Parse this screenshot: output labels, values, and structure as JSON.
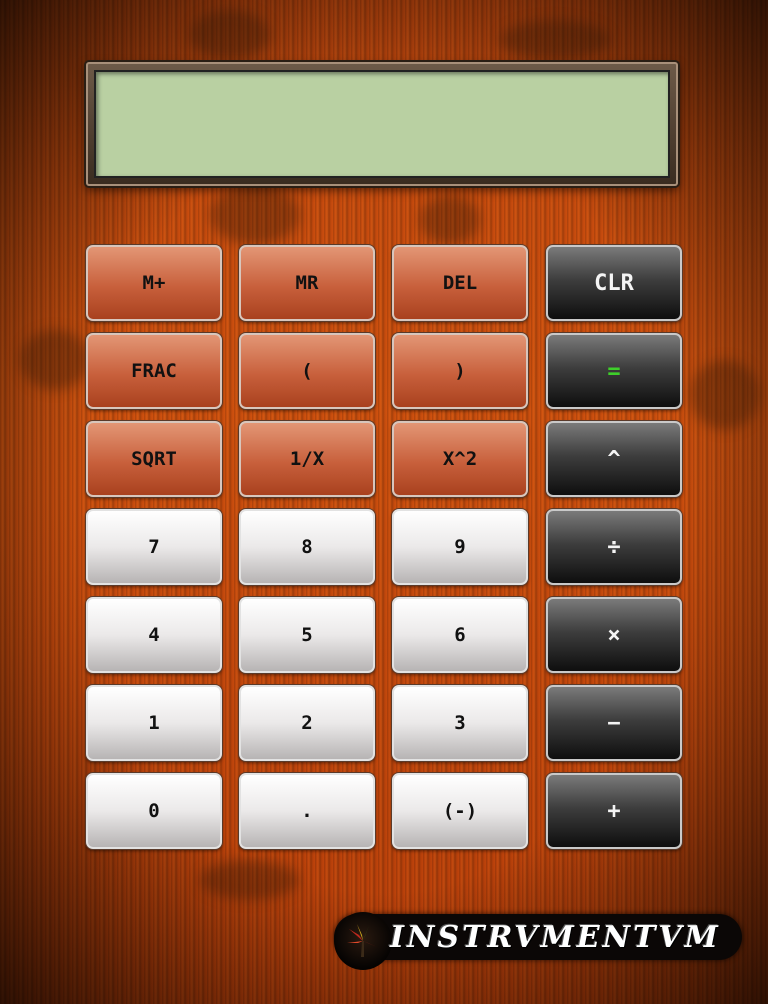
{
  "display": {
    "value": ""
  },
  "keys": {
    "m_plus": "M+",
    "mr": "MR",
    "del": "DEL",
    "clr": "CLR",
    "frac": "FRAC",
    "lparen": "(",
    "rparen": ")",
    "equals": "=",
    "sqrt": "SQRT",
    "recip": "1/X",
    "square": "X^2",
    "power": "^",
    "seven": "7",
    "eight": "8",
    "nine": "9",
    "divide": "÷",
    "four": "4",
    "five": "5",
    "six": "6",
    "multiply": "×",
    "one": "1",
    "two": "2",
    "three": "3",
    "minus": "−",
    "zero": "0",
    "dot": ".",
    "negate": "(-)",
    "plus": "+"
  },
  "brand": {
    "name": "INSTRVMENTVM",
    "emblem_icon": "flower-emblem-icon"
  },
  "colors": {
    "wood": "#c84c0e",
    "lcd": "#b9d0a2",
    "rust_key": "#c8603c",
    "white_key": "#ebe9e9",
    "dark_key": "#2a2a2a",
    "equals_text": "#3ecf2a"
  }
}
